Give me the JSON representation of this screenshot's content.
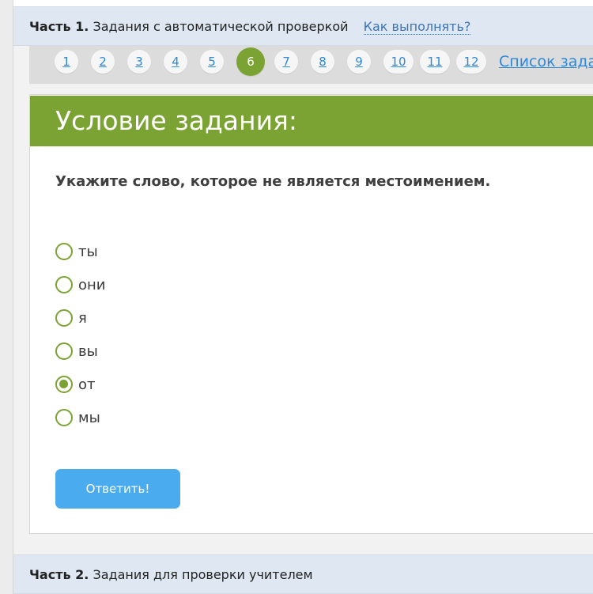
{
  "part1": {
    "prefix": "Часть 1.",
    "title": "Задания с автоматической проверкой",
    "how_link": "Как выполнять?"
  },
  "pager": {
    "pages": [
      "1",
      "2",
      "3",
      "4",
      "5",
      "6",
      "7",
      "8",
      "9",
      "10",
      "11",
      "12"
    ],
    "current": "6",
    "task_list_link": "Список задан"
  },
  "task": {
    "header": "Условие задания:",
    "question": "Укажите слово, которое не является местоимением.",
    "options": [
      "ты",
      "они",
      "я",
      "вы",
      "от",
      "мы"
    ],
    "selected": "от",
    "submit_label": "Ответить!"
  },
  "part2": {
    "prefix": "Часть 2.",
    "title": "Задания для проверки учителем"
  },
  "colors": {
    "accent_green": "#7ba333",
    "link_blue": "#2d88d9",
    "button_blue": "#4aacef",
    "header_bg": "#dfe8f2"
  }
}
